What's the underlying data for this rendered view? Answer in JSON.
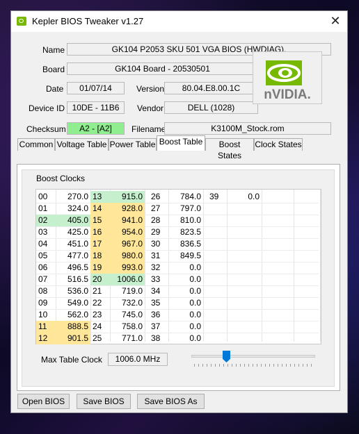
{
  "window": {
    "title": "Kepler BIOS Tweaker v1.27",
    "close_glyph": "✕"
  },
  "info": {
    "name_label": "Name",
    "name_value": "GK104 P2053 SKU 501 VGA BIOS (HWDIAG).",
    "board_label": "Board",
    "board_value": "GK104 Board - 20530501",
    "date_label": "Date",
    "date_value": "01/07/14",
    "version_label": "Version",
    "version_value": "80.04.E8.00.1C",
    "device_label": "Device ID",
    "device_value": "10DE - 11B6",
    "vendor_label": "Vendor",
    "vendor_value": "DELL (1028)",
    "checksum_label": "Checksum",
    "checksum_value": "A2 - [A2]",
    "filename_label": "Filename",
    "filename_value": "K3100M_Stock.rom",
    "logo_text": "nVIDIA."
  },
  "tabs": [
    "Common",
    "Voltage Table",
    "Power Table",
    "Boost Table",
    "Boost States",
    "Clock States"
  ],
  "active_tab": "Boost Table",
  "boost": {
    "group_label": "Boost Clocks",
    "columns": [
      [
        [
          "00",
          "270.0",
          ""
        ],
        [
          "01",
          "324.0",
          ""
        ],
        [
          "02",
          "405.0",
          "g"
        ],
        [
          "03",
          "425.0",
          ""
        ],
        [
          "04",
          "451.0",
          ""
        ],
        [
          "05",
          "477.0",
          ""
        ],
        [
          "06",
          "496.5",
          ""
        ],
        [
          "07",
          "516.5",
          ""
        ],
        [
          "08",
          "536.0",
          ""
        ],
        [
          "09",
          "549.0",
          ""
        ],
        [
          "10",
          "562.0",
          ""
        ],
        [
          "11",
          "888.5",
          "y"
        ],
        [
          "12",
          "901.5",
          "y"
        ]
      ],
      [
        [
          "13",
          "915.0",
          "g"
        ],
        [
          "14",
          "928.0",
          "y"
        ],
        [
          "15",
          "941.0",
          "y"
        ],
        [
          "16",
          "954.0",
          "y"
        ],
        [
          "17",
          "967.0",
          "y"
        ],
        [
          "18",
          "980.0",
          "y"
        ],
        [
          "19",
          "993.0",
          "y"
        ],
        [
          "20",
          "1006.0",
          "g"
        ],
        [
          "21",
          "719.0",
          ""
        ],
        [
          "22",
          "732.0",
          ""
        ],
        [
          "23",
          "745.0",
          ""
        ],
        [
          "24",
          "758.0",
          ""
        ],
        [
          "25",
          "771.0",
          ""
        ]
      ],
      [
        [
          "26",
          "784.0",
          ""
        ],
        [
          "27",
          "797.0",
          ""
        ],
        [
          "28",
          "810.0",
          ""
        ],
        [
          "29",
          "823.5",
          ""
        ],
        [
          "30",
          "836.5",
          ""
        ],
        [
          "31",
          "849.5",
          ""
        ],
        [
          "32",
          "0.0",
          ""
        ],
        [
          "33",
          "0.0",
          ""
        ],
        [
          "34",
          "0.0",
          ""
        ],
        [
          "35",
          "0.0",
          ""
        ],
        [
          "36",
          "0.0",
          ""
        ],
        [
          "37",
          "0.0",
          ""
        ],
        [
          "38",
          "0.0",
          ""
        ]
      ],
      [
        [
          "39",
          "0.0",
          ""
        ]
      ]
    ],
    "max_label": "Max Table Clock",
    "max_value": "1006.0 MHz"
  },
  "buttons": {
    "open": "Open BIOS",
    "save": "Save BIOS",
    "save_as": "Save BIOS As"
  },
  "colors": {
    "green_cell": "#c6efce",
    "yellow_cell": "#ffe699",
    "checksum_ok": "#90ee90",
    "nvidia_green": "#76b900",
    "accent": "#0078d7"
  }
}
